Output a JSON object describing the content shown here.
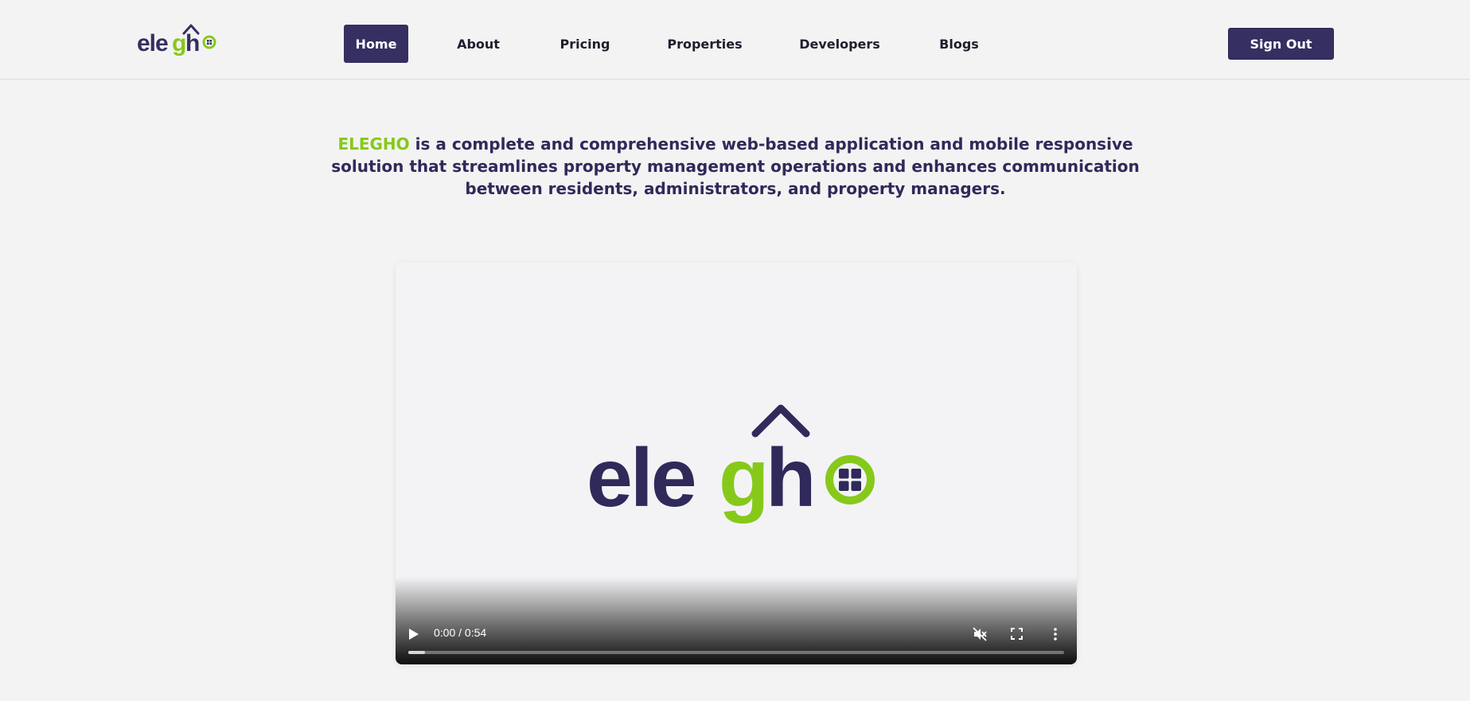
{
  "header": {
    "logo": {
      "wordmark": "elegho",
      "icon": "elegho-house-logo"
    },
    "nav": [
      {
        "label": "Home",
        "active": true
      },
      {
        "label": "About",
        "active": false
      },
      {
        "label": "Pricing",
        "active": false
      },
      {
        "label": "Properties",
        "active": false
      },
      {
        "label": "Developers",
        "active": false
      },
      {
        "label": "Blogs",
        "active": false
      }
    ],
    "signout_label": "Sign Out"
  },
  "intro": {
    "brand": "ELEGHO",
    "text": " is a complete and comprehensive web-based application and mobile responsive solution that streamlines property management operations and enhances communication between residents, administrators, and property managers."
  },
  "video": {
    "poster_logo": "elegho",
    "time_display": "0:00 / 0:54",
    "progress": 0.025,
    "icons": {
      "play": "play-icon",
      "mute": "muted-speaker-icon",
      "fullscreen": "fullscreen-icon",
      "more": "more-vertical-icon"
    }
  },
  "colors": {
    "brand_dark": "#352f62",
    "brand_green": "#86c91a",
    "background": "#f3f3f3"
  }
}
